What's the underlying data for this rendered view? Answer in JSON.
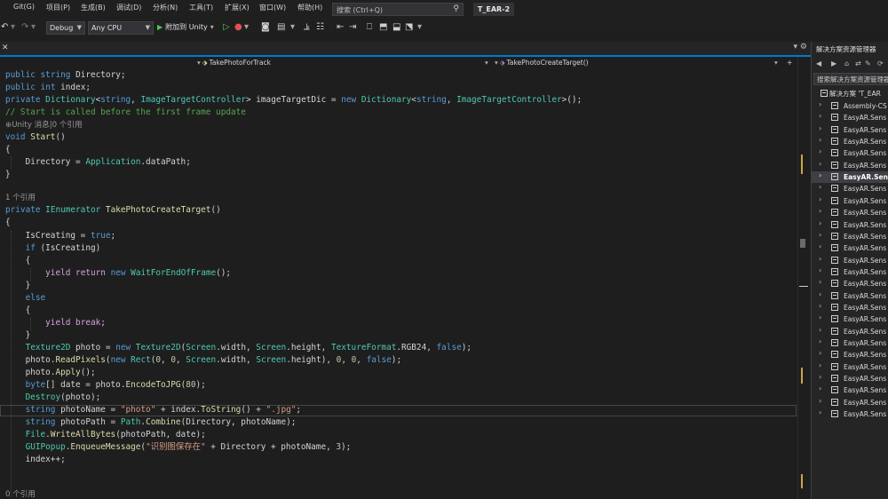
{
  "menu": [
    "Git(G)",
    "项目(P)",
    "生成(B)",
    "调试(D)",
    "分析(N)",
    "工具(T)",
    "扩展(X)",
    "窗口(W)",
    "帮助(H)"
  ],
  "search_placeholder": "搜索 (Ctrl+Q)",
  "project_name": "T_EAR-2",
  "toolbar": {
    "config": "Debug",
    "platform": "Any CPU",
    "attach_label": "附加到 Unity"
  },
  "nav": {
    "left": "TakePhotoForTrack",
    "right": "TakePhotoCreateTarget()"
  },
  "code_lines": [
    "public string Directory;",
    "public int index;",
    "private Dictionary<string, ImageTargetController> imageTargetDic = new Dictionary<string, ImageTargetController>();",
    "// Start is called before the first frame update",
    "⊕Unity 消息|0 个引用",
    "void Start()",
    "{",
    "    Directory = Application.dataPath;",
    "}",
    "",
    "1 个引用",
    "private IEnumerator TakePhotoCreateTarget()",
    "{",
    "    IsCreating = true;",
    "    if (IsCreating)",
    "    {",
    "        yield return new WaitForEndOfFrame();",
    "    }",
    "    else",
    "    {",
    "        yield break;",
    "    }",
    "    Texture2D photo = new Texture2D(Screen.width, Screen.height, TextureFormat.RGB24, false);",
    "    photo.ReadPixels(new Rect(0, 0, Screen.width, Screen.height), 0, 0, false);",
    "    photo.Apply();",
    "    byte[] date = photo.EncodeToJPG(80);",
    "    Destroy(photo);",
    "    string photoName = \"photo\" + index.ToString() + \".jpg\";",
    "    string photoPath = Path.Combine(Directory, photoName);",
    "    File.WriteAllBytes(photoPath, date);",
    "    GUIPopup.EnqueueMessage(\"识别图保存在\" + Directory + photoName, 3);",
    "    index++;",
    "",
    "0 个引用"
  ],
  "solution_explorer": {
    "title": "解决方案资源管理器",
    "search_placeholder": "搜索解决方案资源管理器",
    "root": "解决方案 'T_EAR",
    "projects": [
      "Assembly-CS",
      "EasyAR.Sens",
      "EasyAR.Sens",
      "EasyAR.Sens",
      "EasyAR.Sens",
      "EasyAR.Sens",
      "EasyAR.Sens",
      "EasyAR.Sens",
      "EasyAR.Sens",
      "EasyAR.Sens",
      "EasyAR.Sens",
      "EasyAR.Sens",
      "EasyAR.Sens",
      "EasyAR.Sens",
      "EasyAR.Sens",
      "EasyAR.Sens",
      "EasyAR.Sens",
      "EasyAR.Sens",
      "EasyAR.Sens",
      "EasyAR.Sens",
      "EasyAR.Sens",
      "EasyAR.Sens",
      "EasyAR.Sens",
      "EasyAR.Sens",
      "EasyAR.Sens",
      "EasyAR.Sens",
      "EasyAR.Sens"
    ],
    "selected_index": 6
  },
  "colors": {
    "background": "#1e1e1e",
    "keyword": "#569cd6",
    "type": "#4ec9b0",
    "method": "#dcdcaa",
    "string": "#d69d85",
    "number": "#b5cea8",
    "comment": "#57a64a",
    "accent": "#007acc"
  }
}
